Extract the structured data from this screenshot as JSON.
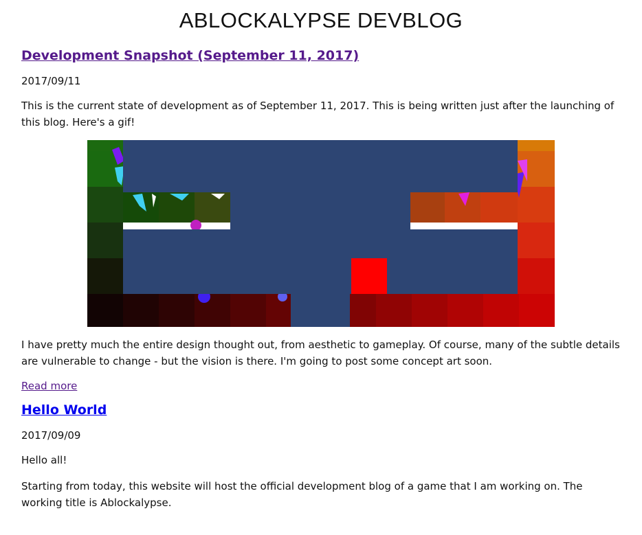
{
  "site": {
    "title": "ABLOCKALYPSE DEVBLOG"
  },
  "posts": [
    {
      "title": "Development Snapshot (September 11, 2017)",
      "date": "2017/09/11",
      "paragraphs": [
        "This is the current state of development as of September 11, 2017. This is being written just after the launching of this blog. Here's a gif!",
        "I have pretty much the entire design thought out, from aesthetic to gameplay. Of course, many of the subtle details are vulnerable to change - but the vision is there. I'm going to post some concept art soon."
      ],
      "read_more": "Read more",
      "link_color": "#551a8b"
    },
    {
      "title": "Hello World",
      "date": "2017/09/09",
      "paragraphs": [
        "Hello all!",
        "Starting from today, this website will host the official development blog of a game that I am working on. The working title is Ablockalypse."
      ],
      "link_color": "#0000ee"
    }
  ],
  "gif": {
    "level_color": "#2d4573",
    "player_color": "#ff0000"
  }
}
